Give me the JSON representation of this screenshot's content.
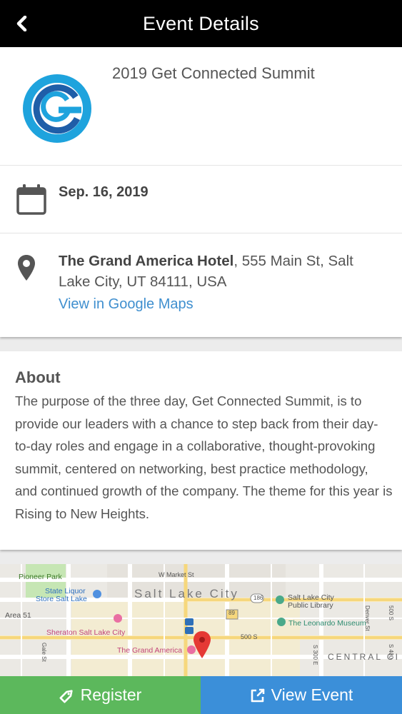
{
  "header": {
    "title": "Event Details",
    "back_icon": "chevron-left-icon"
  },
  "event": {
    "name": "2019 Get Connected Summit",
    "logo": "gc-logo",
    "date": "Sep. 16, 2019",
    "venue": "The Grand America Hotel",
    "address": ", 555 Main St, Salt Lake City, UT 84111, USA",
    "maps_link": "View in Google Maps"
  },
  "about": {
    "title": "About",
    "text": "The purpose of the three day, Get Connected Summit, is to provide our leaders with a chance to step back from their day-to-day roles and engage in a collaborative, thought-provoking summit, centered on networking, best practice methodology, and continued growth of the company. The theme for this year is Rising to New Heights."
  },
  "map": {
    "labels": {
      "pioneer_park": "Pioneer Park",
      "market_st": "W Market St",
      "state_liquor": "State Liquor",
      "state_liquor_2": "Store Salt Lake",
      "city": "Salt Lake City",
      "route_186": "186",
      "library_1": "Salt Lake City",
      "library_2": "Public Library",
      "denver_st": "Denver St",
      "s500": "500 S",
      "area51": "Area 51",
      "route_89": "89",
      "sheraton": "Sheraton Salt Lake City",
      "leonardo": "The Leonardo Museum",
      "grand_america": "The Grand America",
      "s500_road": "500 S",
      "s300e": "S 300 E",
      "central": "CENTRAL CI",
      "gale_st": "Gale St",
      "s400": "S 400"
    }
  },
  "buttons": {
    "register": "Register",
    "view_event": "View Event"
  },
  "colors": {
    "header_bg": "#000000",
    "link": "#3f8fcf",
    "register_bg": "#5cb85c",
    "view_event_bg": "#3b8fd9",
    "logo_outer": "#1ea3dd",
    "logo_inner": "#1f5ea8",
    "map_pin": "#e53935"
  }
}
